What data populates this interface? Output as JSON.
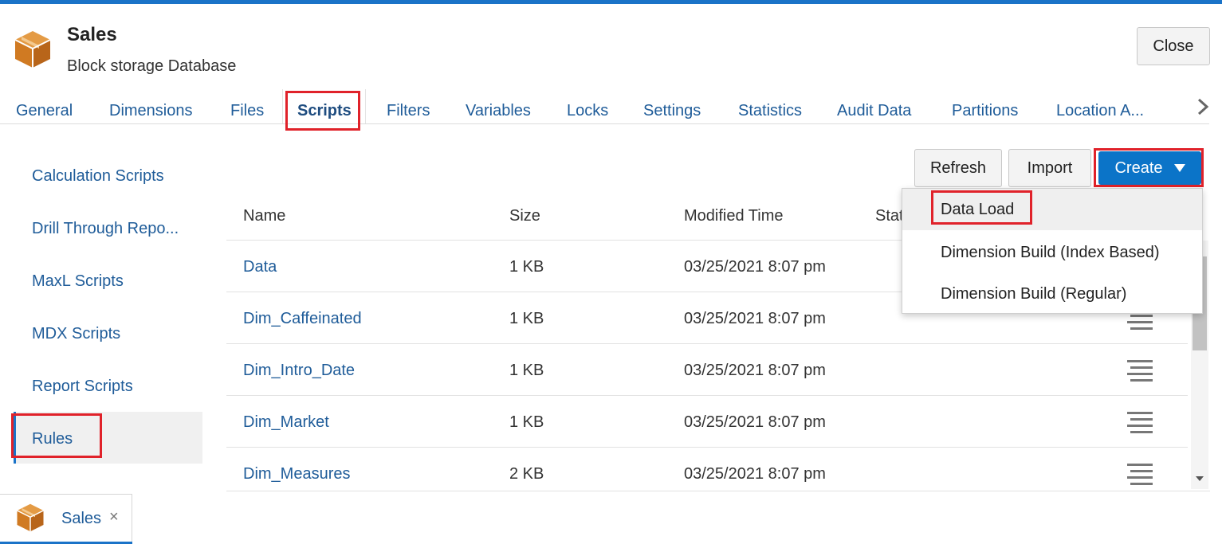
{
  "header": {
    "title": "Sales",
    "subtitle": "Block storage Database",
    "close_label": "Close",
    "icon": "cube-icon"
  },
  "tabs": [
    {
      "label": "General"
    },
    {
      "label": "Dimensions"
    },
    {
      "label": "Files"
    },
    {
      "label": "Scripts",
      "active": true
    },
    {
      "label": "Filters"
    },
    {
      "label": "Variables"
    },
    {
      "label": "Locks"
    },
    {
      "label": "Settings"
    },
    {
      "label": "Statistics"
    },
    {
      "label": "Audit Data"
    },
    {
      "label": "Partitions"
    },
    {
      "label": "Location A..."
    }
  ],
  "sidebar": {
    "items": [
      {
        "label": "Calculation Scripts"
      },
      {
        "label": "Drill Through Repo..."
      },
      {
        "label": "MaxL Scripts"
      },
      {
        "label": "MDX Scripts"
      },
      {
        "label": "Report Scripts"
      },
      {
        "label": "Rules",
        "active": true
      }
    ]
  },
  "toolbar": {
    "refresh_label": "Refresh",
    "import_label": "Import",
    "create_label": "Create"
  },
  "table": {
    "columns": [
      "Name",
      "Size",
      "Modified Time",
      "Stat"
    ],
    "rows": [
      {
        "name": "Data",
        "size": "1 KB",
        "modified": "03/25/2021 8:07 pm"
      },
      {
        "name": "Dim_Caffeinated",
        "size": "1 KB",
        "modified": "03/25/2021 8:07 pm"
      },
      {
        "name": "Dim_Intro_Date",
        "size": "1 KB",
        "modified": "03/25/2021 8:07 pm"
      },
      {
        "name": "Dim_Market",
        "size": "1 KB",
        "modified": "03/25/2021 8:07 pm"
      },
      {
        "name": "Dim_Measures",
        "size": "2 KB",
        "modified": "03/25/2021 8:07 pm"
      }
    ]
  },
  "create_menu": {
    "items": [
      {
        "label": "Data Load"
      },
      {
        "label": "Dimension Build (Index Based)"
      },
      {
        "label": "Dimension Build (Regular)"
      }
    ]
  },
  "bottom_tab": {
    "label": "Sales",
    "close": "×"
  },
  "colors": {
    "accent": "#0b74c8",
    "link": "#1f5c99",
    "highlight": "#e0222a",
    "icon_orange": "#d9822b"
  }
}
